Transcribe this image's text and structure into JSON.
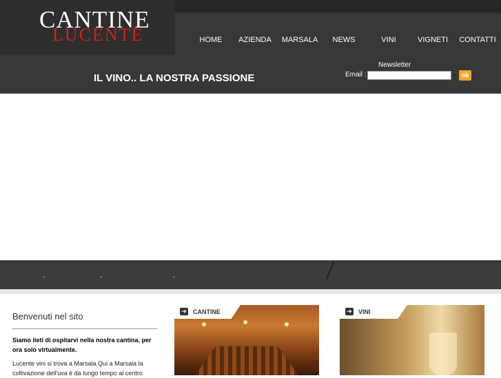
{
  "logo": {
    "line1": "CANTINE",
    "line2": "LUCENTE"
  },
  "nav": {
    "items": [
      "HOME",
      "AZIENDA",
      "MARSALA",
      "NEWS",
      "VINI",
      "VIGNETI",
      "CONTATTI"
    ]
  },
  "slogan": "IL VINO.. LA NOSTRA PASSIONE",
  "newsletter": {
    "title": "Newsletter",
    "email_label": "Email :",
    "email_value": "",
    "submit_label": "ok"
  },
  "welcome": {
    "title": "Benvenuti nel sito",
    "intro_bold": "Siamo lieti di ospitarvi nella nostra cantina, per ora solo virtualmente.",
    "body": "Lucente vini si trova a Marsala.Qui a Marsala la coltivazione dell'uva è da lungo tempo al centro"
  },
  "boxes": [
    {
      "label": "CANTINE",
      "icon": "arrow-right-icon"
    },
    {
      "label": "VINI",
      "icon": "arrow-right-icon"
    }
  ],
  "colors": {
    "header_bg": "#373737",
    "logo_red": "#d51e1e",
    "ok_button": "#f3a52a",
    "strip_bg": "#3c3c3c"
  }
}
